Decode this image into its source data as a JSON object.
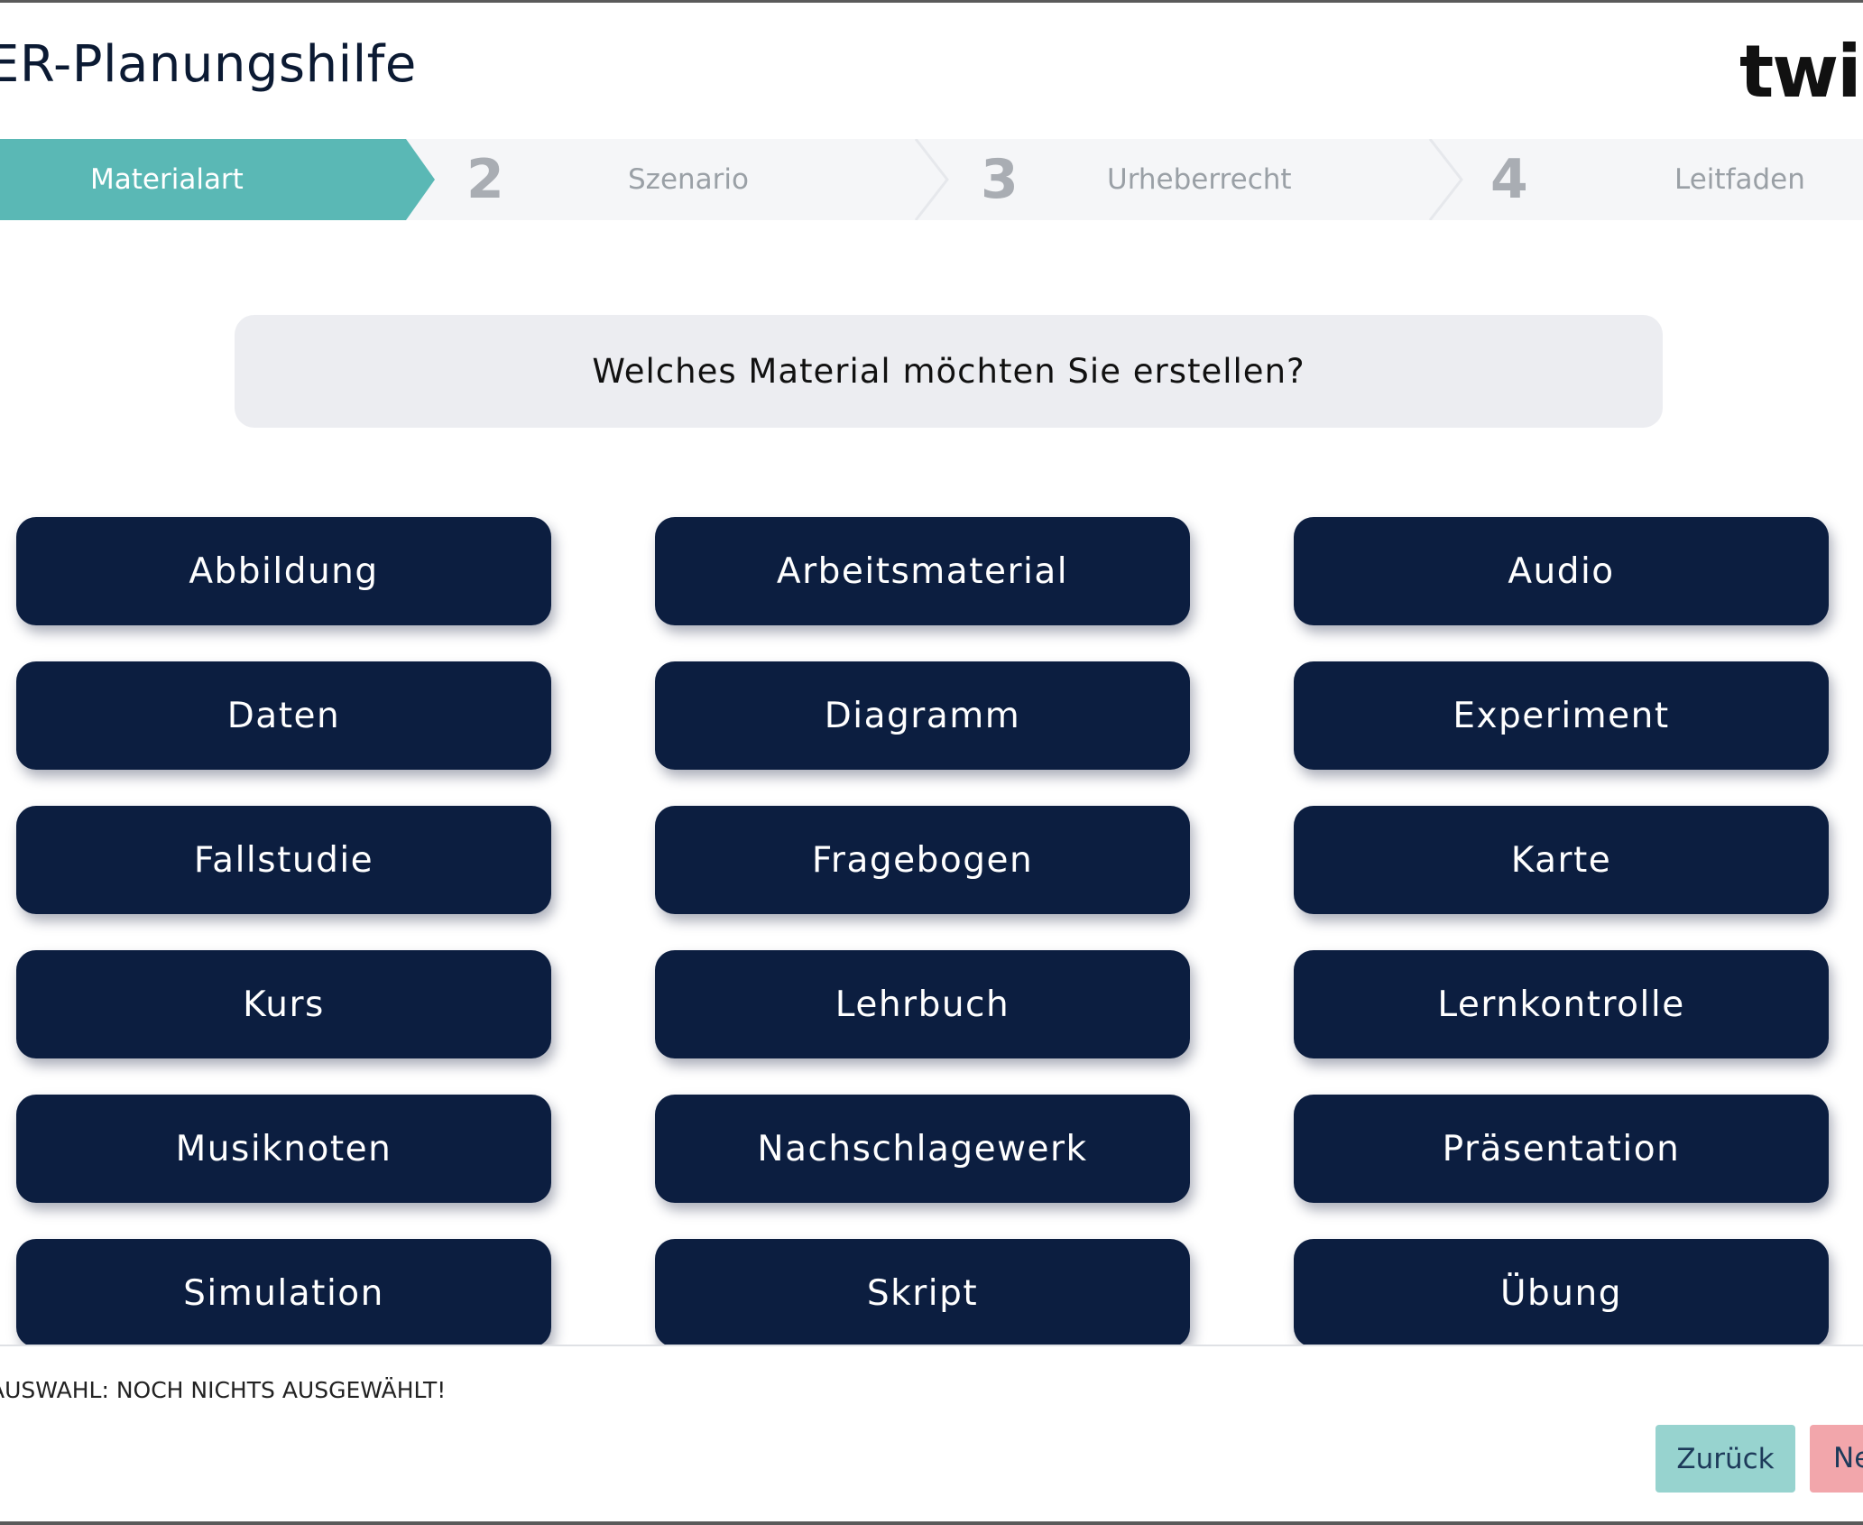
{
  "header": {
    "title": "ER-Planungshilfe",
    "logo_text": "twill"
  },
  "stepper": {
    "steps": [
      {
        "number": "",
        "label": "Materialart",
        "active": true
      },
      {
        "number": "2",
        "label": "Szenario",
        "active": false
      },
      {
        "number": "3",
        "label": "Urheberrecht",
        "active": false
      },
      {
        "number": "4",
        "label": "Leitfaden",
        "active": false
      }
    ]
  },
  "question": "Welches Material möchten Sie erstellen?",
  "materials": [
    "Abbildung",
    "Arbeitsmaterial",
    "Audio",
    "Daten",
    "Diagramm",
    "Experiment",
    "Fallstudie",
    "Fragebogen",
    "Karte",
    "Kurs",
    "Lehrbuch",
    "Lernkontrolle",
    "Musiknoten",
    "Nachschlagewerk",
    "Präsentation",
    "Simulation",
    "Skript",
    "Übung"
  ],
  "footer": {
    "selection_status": "AUSWAHL: NOCH NICHTS AUSGEWÄHLT!",
    "back_label": "Zurück",
    "next_label": "Ne"
  },
  "colors": {
    "accent": "#5ab8b5",
    "button_bg": "#0c1e40",
    "back_button": "#97d3cf",
    "next_button": "#f2a6ab"
  }
}
